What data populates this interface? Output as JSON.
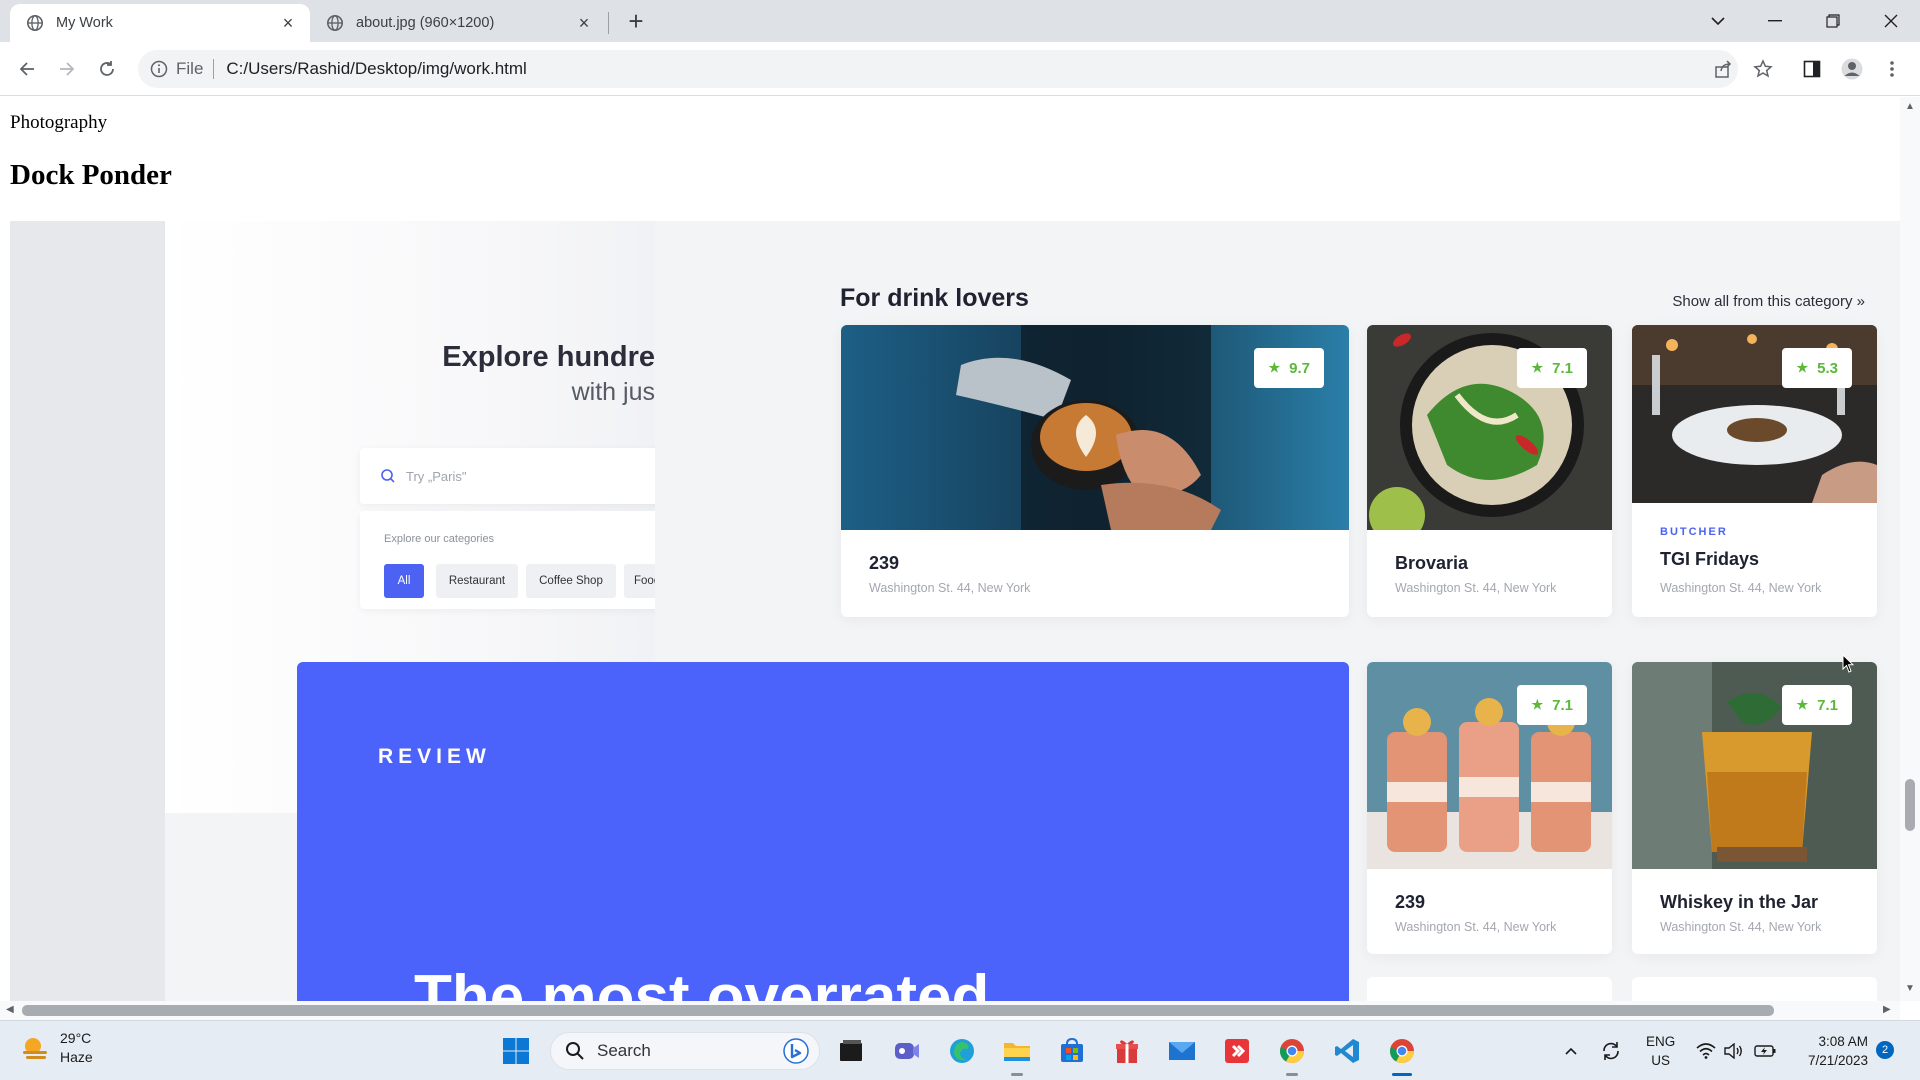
{
  "browser": {
    "tabs": [
      {
        "title": "My Work",
        "active": true
      },
      {
        "title": "about.jpg (960×1200)",
        "active": false
      }
    ],
    "address": {
      "scheme": "File",
      "url": "C:/Users/Rashid/Desktop/img/work.html"
    }
  },
  "page": {
    "subtitle": "Photography",
    "title": "Dock Ponder"
  },
  "design": {
    "hero": {
      "title": "Explore hundre",
      "subtitle": "with jus",
      "search_placeholder": "Try „Paris\"",
      "categories_label": "Explore our categories",
      "chips": [
        "All",
        "Restaurant",
        "Coffee Shop",
        "Food"
      ]
    },
    "section": {
      "title": "For drink lovers",
      "link": "Show all from this category »"
    },
    "cards": [
      {
        "rating": "9.7",
        "name": "239",
        "address": "Washington St. 44, New York",
        "kicker": ""
      },
      {
        "rating": "7.1",
        "name": "Brovaria",
        "address": "Washington St. 44, New York",
        "kicker": ""
      },
      {
        "rating": "5.3",
        "name": "TGI Fridays",
        "address": "Washington St. 44, New York",
        "kicker": "BUTCHER"
      },
      {
        "rating": "7.1",
        "name": "239",
        "address": "Washington St. 44, New York",
        "kicker": ""
      },
      {
        "rating": "7.1",
        "name": "Whiskey in the Jar",
        "address": "Washington St. 44, New York",
        "kicker": ""
      }
    ],
    "review": {
      "kicker": "REVIEW",
      "headline": "The most overrated"
    },
    "colors": {
      "accent": "#4b62fb",
      "rating": "#5bb83a"
    }
  },
  "taskbar": {
    "weather": {
      "temp": "29°C",
      "condition": "Haze"
    },
    "search_label": "Search",
    "language": {
      "line1": "ENG",
      "line2": "US"
    },
    "clock": {
      "time": "3:08 AM",
      "date": "7/21/2023"
    },
    "notifications": "2",
    "apps": [
      "start-icon",
      "search-icon",
      "file-viewer-icon",
      "teams-icon",
      "edge-icon",
      "file-explorer-icon",
      "microsoft-store-icon",
      "gift-icon",
      "mail-icon",
      "anydesk-icon",
      "chrome-icon",
      "vscode-icon",
      "chrome-icon"
    ]
  }
}
